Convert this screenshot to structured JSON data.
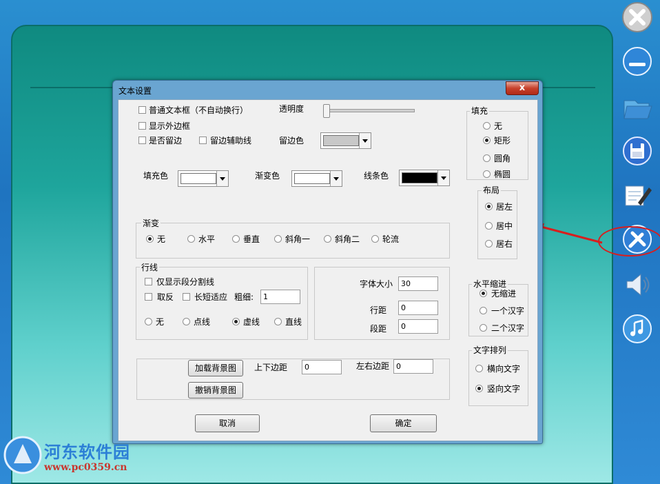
{
  "dialog": {
    "title": "文本设置",
    "close_label": "x"
  },
  "options": {
    "plain_textbox": "普通文本框（不自动换行）",
    "show_border": "显示外边框",
    "margin": "是否留边",
    "margin_guides": "留边辅助线",
    "opacity_label": "透明度",
    "margin_color_label": "留边色",
    "margin_color": "#c8c8c8"
  },
  "colors": {
    "fill_label": "填充色",
    "fill_value": "#ffffff",
    "gradient_label": "渐变色",
    "gradient_value": "#ffffff",
    "line_label": "线条色",
    "line_value": "#000000"
  },
  "gradient": {
    "title": "渐变",
    "options": [
      "无",
      "水平",
      "垂直",
      "斜角一",
      "斜角二",
      "轮流"
    ],
    "selected": "无"
  },
  "lines": {
    "title": "行线",
    "only_paragraph": "仅显示段分割线",
    "invert": "取反",
    "dash_adapt": "长短适应",
    "thickness_label": "粗细:",
    "thickness_value": "1",
    "styles": [
      "无",
      "点线",
      "虚线",
      "直线"
    ],
    "selected": "虚线"
  },
  "font": {
    "size_label": "字体大小",
    "size_value": "30",
    "line_spacing_label": "行距",
    "line_spacing_value": "0",
    "para_spacing_label": "段距",
    "para_spacing_value": "0"
  },
  "background": {
    "load_button": "加载背景图",
    "cancel_button": "撤销背景图",
    "tb_margin_label": "上下边距",
    "tb_margin_value": "0",
    "lr_margin_label": "左右边距",
    "lr_margin_value": "0"
  },
  "fill": {
    "title": "填充",
    "options": [
      "无",
      "矩形",
      "圆角",
      "椭圆"
    ],
    "selected": "矩形"
  },
  "layout": {
    "title": "布局",
    "options": [
      "居左",
      "居中",
      "居右"
    ],
    "selected": "居左"
  },
  "indent": {
    "title": "水平缩进",
    "options": [
      "无缩进",
      "一个汉字",
      "二个汉字"
    ],
    "selected": "无缩进"
  },
  "direction": {
    "title": "文字排列",
    "options": [
      "横向文字",
      "竖向文字"
    ],
    "selected": "竖向文字"
  },
  "buttons": {
    "cancel": "取消",
    "ok": "确定"
  },
  "watermark": {
    "name": "河东软件园",
    "url": "www.pc0359.cn"
  },
  "toolbar_icons": [
    "close-icon",
    "minimize-icon",
    "open-folder-icon",
    "save-icon",
    "edit-icon",
    "settings-tools-icon",
    "speaker-icon",
    "music-icon"
  ],
  "accent": {
    "highlight": "#d81e1e",
    "app_panel": "#1ea59c",
    "desktop": "#1f74c0"
  }
}
